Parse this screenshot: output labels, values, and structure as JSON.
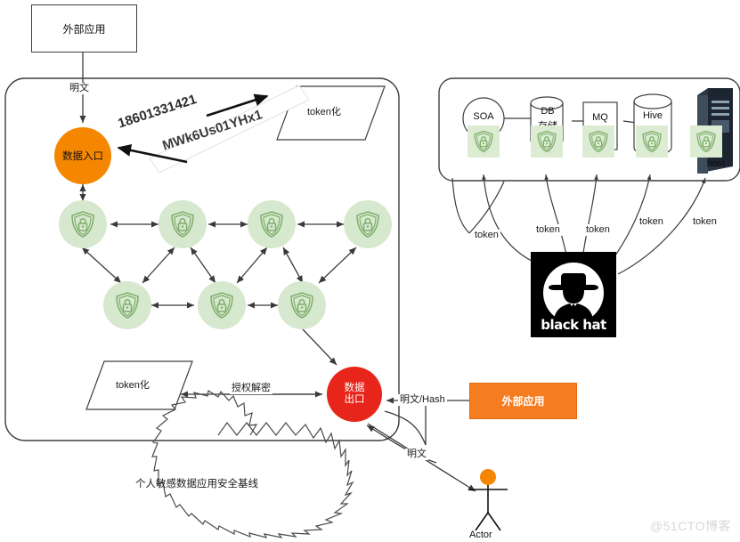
{
  "diagram": {
    "title": "个人敏感数据应用安全基线",
    "watermark": "@51CTO博客",
    "colors": {
      "entry_orange": "#f58700",
      "exit_red": "#e8251a",
      "external_app_orange": "#f57c1f",
      "shield_green": "#7fae6c",
      "node_fill": "#d6e8ce",
      "badge_fill": "#dcecd3",
      "stroke": "#3f3f3f"
    }
  },
  "top": {
    "external_app": "外部应用",
    "plaintext_edge": "明文"
  },
  "tokenization": {
    "raw_value": "18601331421",
    "token_value": "MWk6Us01YHx1",
    "shape_label": "token化"
  },
  "entry": {
    "label": "数据入口"
  },
  "mesh": {
    "node_icon": "shield-lock-icon",
    "top_row_count": 4,
    "bottom_row_count": 3
  },
  "exit": {
    "label_line1": "数据",
    "label_line2": "出口",
    "decrypt_edge": "授权解密",
    "token_shape": "token化",
    "plaintext_hash_edge": "明文/Hash",
    "plaintext_edge": "明文"
  },
  "bottom_right": {
    "external_app": "外部应用",
    "actor": "Actor"
  },
  "baseline": {
    "label": "个人敏感数据应用安全基线"
  },
  "right_panel": {
    "nodes": [
      {
        "id": "soa",
        "label": "SOA",
        "shape": "circle",
        "badge": "shield-lock-icon"
      },
      {
        "id": "db",
        "label": "DB",
        "label2": "存储",
        "shape": "cylinder",
        "badge": "shield-lock-icon"
      },
      {
        "id": "mq",
        "label": "MQ",
        "shape": "rectangle",
        "badge": "shield-lock-icon"
      },
      {
        "id": "hive",
        "label": "Hive",
        "shape": "cylinder",
        "badge": "shield-lock-icon"
      },
      {
        "id": "host",
        "label": "host",
        "shape": "server",
        "badge": "shield-lock-icon"
      }
    ],
    "token_edges": [
      "token",
      "token",
      "token",
      "token",
      "token"
    ]
  },
  "attacker": {
    "name": "black hat",
    "logo_text": "black hat"
  }
}
